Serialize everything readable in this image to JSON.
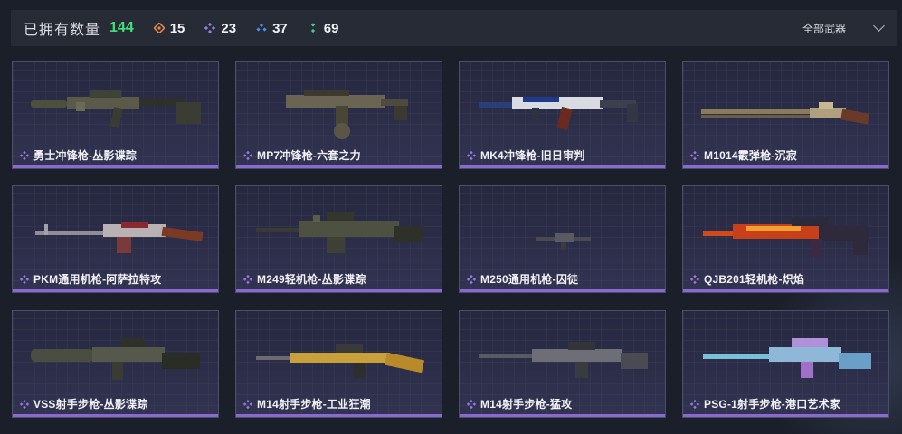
{
  "header": {
    "owned_label": "已拥有数量",
    "owned_count": "144",
    "stats": [
      {
        "icon": "orange-rarity-icon",
        "value": "15",
        "color": "#e58a4a"
      },
      {
        "icon": "purple-rarity-icon",
        "value": "23",
        "color": "#9a79e0"
      },
      {
        "icon": "blue-rarity-icon",
        "value": "37",
        "color": "#4f8fe0"
      },
      {
        "icon": "green-rarity-icon",
        "value": "69",
        "color": "#3ccf8e"
      }
    ],
    "filter_label": "全部武器"
  },
  "colors": {
    "accent_green": "#3fe07e",
    "rarity_purple": "#8a6ad0",
    "card_border": "#4a4e68"
  },
  "weapons": [
    {
      "name": "勇士冲锋枪-丛影谍踪",
      "icon": "purple-rarity-icon"
    },
    {
      "name": "MP7冲锋枪-六套之力",
      "icon": "purple-rarity-icon"
    },
    {
      "name": "MK4冲锋枪-旧日审判",
      "icon": "purple-rarity-icon"
    },
    {
      "name": "M1014霰弹枪-沉寂",
      "icon": "purple-rarity-icon"
    },
    {
      "name": "PKM通用机枪-阿萨拉特攻",
      "icon": "purple-rarity-icon"
    },
    {
      "name": "M249轻机枪-丛影谍踪",
      "icon": "purple-rarity-icon"
    },
    {
      "name": "M250通用机枪-囚徒",
      "icon": "purple-rarity-icon"
    },
    {
      "name": "QJB201轻机枪-炽焰",
      "icon": "purple-rarity-icon"
    },
    {
      "name": "VSS射手步枪-丛影谍踪",
      "icon": "purple-rarity-icon"
    },
    {
      "name": "M14射手步枪-工业狂潮",
      "icon": "purple-rarity-icon"
    },
    {
      "name": "M14射手步枪-猛攻",
      "icon": "purple-rarity-icon"
    },
    {
      "name": "PSG-1射手步枪-港口艺术家",
      "icon": "purple-rarity-icon"
    }
  ]
}
